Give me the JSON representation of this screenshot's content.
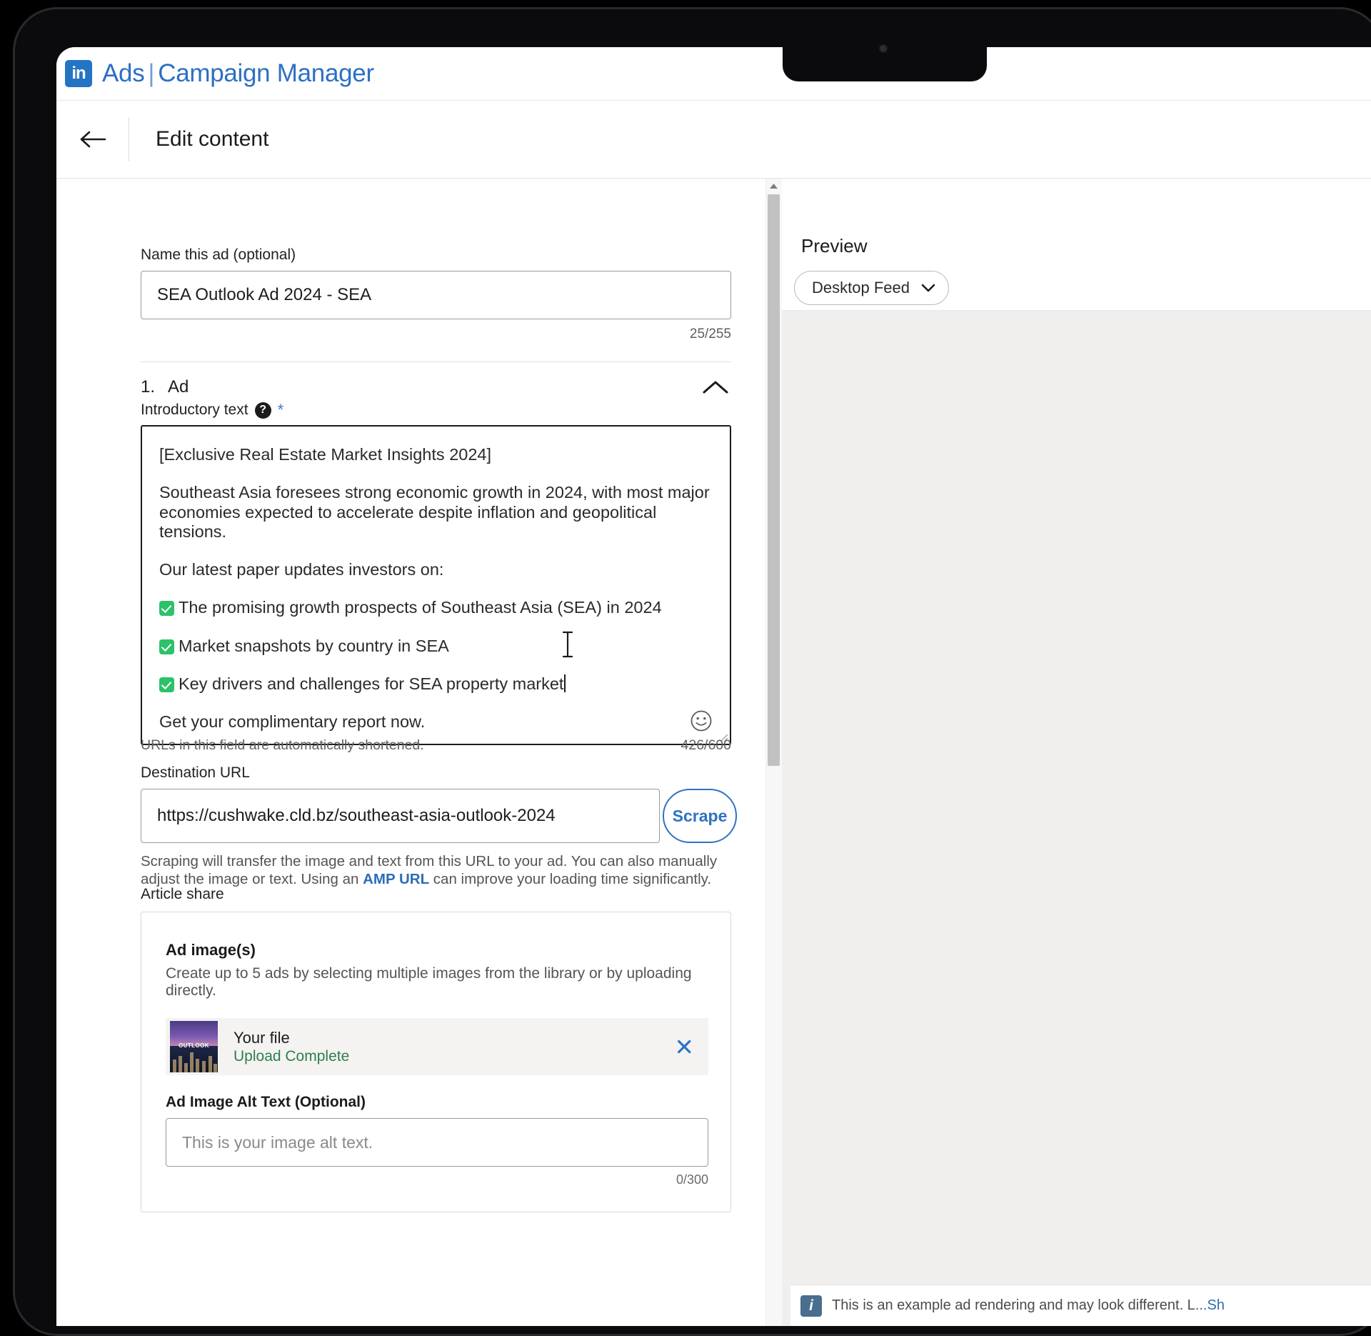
{
  "app": {
    "logo_text": "in",
    "brand_prefix": "Ads",
    "brand_separator": "|",
    "brand_suffix": "Campaign Manager",
    "accent_blue": "#2d6fc4",
    "logo_blue": "#2474c4"
  },
  "titlebar": {
    "back_icon": "arrow-left-icon",
    "title": "Edit content"
  },
  "form": {
    "name_field": {
      "label": "Name this ad (optional)",
      "value": "SEA Outlook Ad 2024 - SEA",
      "counter": "25/255"
    },
    "ad_section": {
      "number": "1.",
      "label": "Ad",
      "collapse_icon": "chevron-up-icon"
    },
    "introductory_text": {
      "label": "Introductory text",
      "help_icon": "question-mark-icon",
      "required_marker": "*",
      "paragraphs": [
        "[Exclusive Real Estate Market Insights 2024]",
        "Southeast Asia foresees strong economic growth in 2024, with most major economies expected to accelerate despite inflation and geopolitical tensions.",
        "Our latest paper updates investors on:"
      ],
      "checklist": [
        "The promising growth prospects of Southeast Asia (SEA) in 2024",
        "Market snapshots by country in SEA",
        "Key drivers and challenges for SEA property market"
      ],
      "closing": "Get your complimentary report now.",
      "emoji_icon": "smiley-face-icon",
      "hint": "URLs in this field are automatically shortened.",
      "counter": "426/600",
      "checkmark_color": "#2bc26a"
    },
    "destination_url": {
      "label": "Destination URL",
      "value": "https://cushwake.cld.bz/southeast-asia-outlook-2024",
      "scrape_button": "Scrape",
      "help_part1": "Scraping will transfer the image and text from this URL to your ad. You can also manually adjust the image or text. Using an ",
      "help_link": "AMP URL",
      "help_part2": " can improve your loading time significantly."
    },
    "article_share": {
      "title": "Article share",
      "ad_images_title": "Ad image(s)",
      "ad_images_sub": "Create up to 5 ads by selecting multiple images from the library or by uploading directly.",
      "file": {
        "thumb_label": "OUTLOOK",
        "name": "Your file",
        "status": "Upload Complete",
        "status_color": "#2f7d4f",
        "remove_icon": "close-icon"
      },
      "alt_text": {
        "label": "Ad Image Alt Text (Optional)",
        "placeholder": "This is your image alt text.",
        "counter": "0/300"
      }
    }
  },
  "preview": {
    "title": "Preview",
    "device_select": {
      "value": "Desktop Feed",
      "chevron_icon": "chevron-down-icon"
    },
    "note": {
      "icon": "info-icon",
      "text": "This is an example ad rendering and may look different. L",
      "link_text": "...Sh"
    }
  },
  "scrollbar": {
    "up_arrow_icon": "triangle-up-icon"
  }
}
